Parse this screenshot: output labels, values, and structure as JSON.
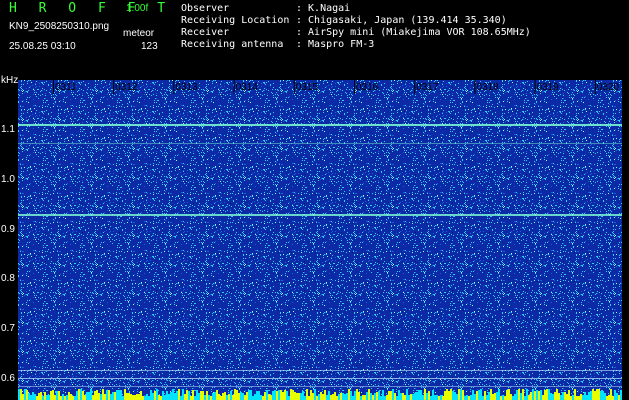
{
  "header": {
    "app_title": "H R O F F T",
    "version": "1.00f",
    "filename": "KN9_2508250310.png",
    "tag": "meteor",
    "datetime": "25.08.25 03:10",
    "count": "123"
  },
  "info": [
    {
      "label": "Observer",
      "value": ": K.Nagai"
    },
    {
      "label": "Receiving Location",
      "value": ": Chigasaki, Japan (139.414 35.340)"
    },
    {
      "label": "Receiver",
      "value": ": AirSpy mini (Miakejima VOR 108.65MHz)"
    },
    {
      "label": "Receiving antenna",
      "value": ": Maspro FM-3"
    }
  ],
  "axis": {
    "unit": "kHz",
    "y_ticks": [
      "1.1",
      "1.0",
      "0.9",
      "0.8",
      "0.7",
      "0.6"
    ],
    "time_ticks": [
      "0311",
      "0312",
      "0313",
      "0314",
      "0315",
      "0316",
      "0317",
      "0318",
      "0319",
      "0320"
    ]
  },
  "colors": {
    "background": "#000000",
    "header_title": "#39ff39",
    "spectrogram_base": "#0c2aa6",
    "noise_dot": "#33ccff",
    "carrier_line": "#7fffd4",
    "bottom_strip_a": "#e8ff00",
    "bottom_strip_b": "#00e5ff"
  }
}
